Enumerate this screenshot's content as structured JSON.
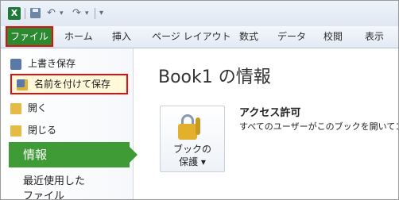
{
  "quick_access": {
    "app_icon": "X",
    "undo_icon": "undo-icon",
    "redo_icon": "redo-icon",
    "customize_icon": "customize-qat-icon"
  },
  "ribbon": {
    "file_tab": "ファイル",
    "tabs": [
      "ホーム",
      "挿入",
      "ページ レイアウト",
      "数式",
      "データ",
      "校閲",
      "表示"
    ]
  },
  "backstage": {
    "items": [
      "上書き保存",
      "名前を付けて保存",
      "開く",
      "閉じる"
    ],
    "selected": "情報",
    "recent_line1": "最近使用した",
    "recent_line2": "ファイル"
  },
  "main": {
    "title": "Book1 の情報",
    "protect_button_line1": "ブックの",
    "protect_button_line2": "保護 ▾",
    "permissions_title": "アクセス許可",
    "permissions_desc": "すべてのユーザーがこのブックを開いてコ"
  },
  "colors": {
    "file_green": "#2b8a2f",
    "highlight_red": "#e01010",
    "info_green": "#3f9b35"
  }
}
